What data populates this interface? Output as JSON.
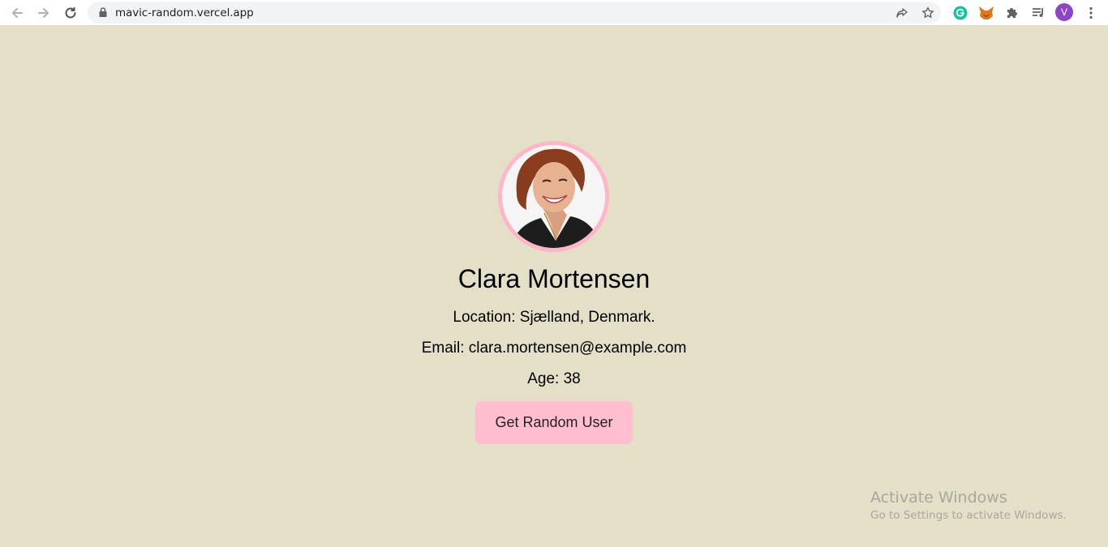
{
  "browser": {
    "url": "mavic-random.vercel.app",
    "profile_initial": "V"
  },
  "user": {
    "name": "Clara Mortensen",
    "location": "Location: Sjælland, Denmark.",
    "email": "Email: clara.mortensen@example.com",
    "age": "Age: 38"
  },
  "actions": {
    "random_label": "Get Random User"
  },
  "watermark": {
    "title": "Activate Windows",
    "subtitle": "Go to Settings to activate Windows."
  },
  "colors": {
    "page_background": "#e3e0c7",
    "accent_pink": "#ffbfcf",
    "photo_border": "#ffb6c8"
  }
}
